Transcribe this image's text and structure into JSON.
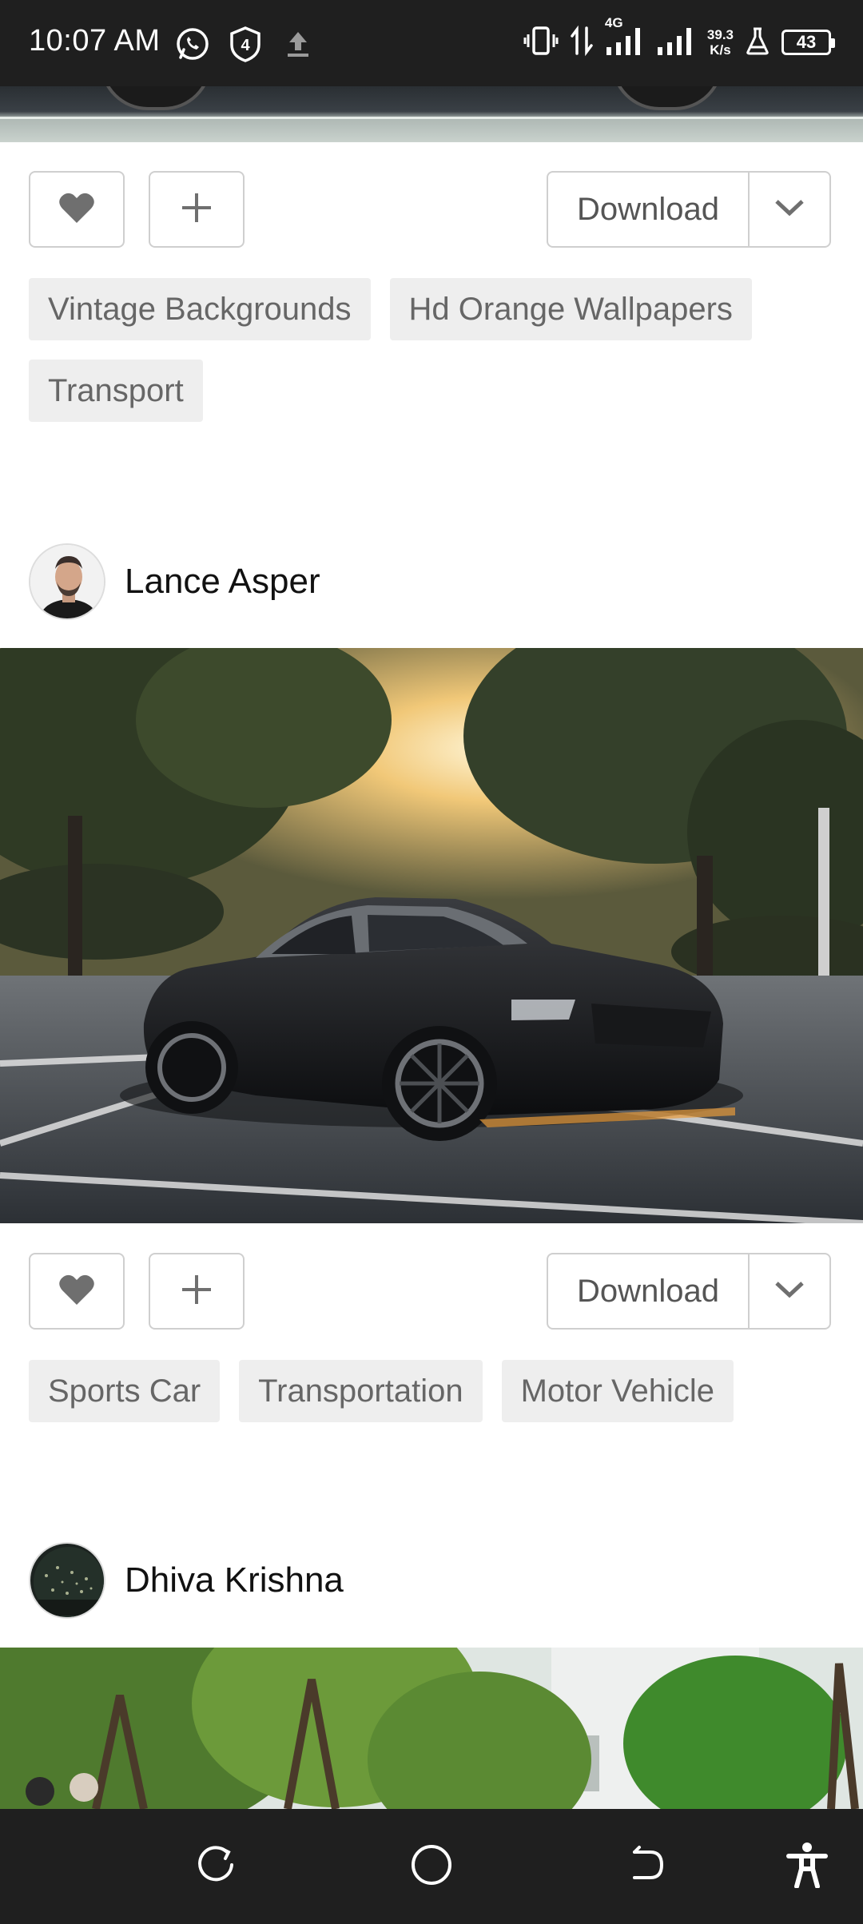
{
  "status_bar": {
    "time": "10:07 AM",
    "network_type": "4G",
    "net_speed_value": "39.3",
    "net_speed_unit": "K/s",
    "battery_level": "43",
    "shield_number": "4"
  },
  "posts": [
    {
      "actions": {
        "download_label": "Download"
      },
      "tags": [
        "Vintage Backgrounds",
        "Hd Orange Wallpapers",
        "Transport"
      ]
    },
    {
      "author": "Lance Asper",
      "actions": {
        "download_label": "Download"
      },
      "tags": [
        "Sports Car",
        "Transportation",
        "Motor Vehicle"
      ]
    },
    {
      "author": "Dhiva Krishna"
    }
  ],
  "icons": {
    "status_left": [
      "whatsapp-icon",
      "shield-icon",
      "upload-icon"
    ],
    "status_right": [
      "vibrate-icon",
      "data-transfer-icon",
      "signal-icon",
      "signal-icon",
      "flask-icon",
      "battery-icon"
    ],
    "post_actions": [
      "heart-icon",
      "plus-icon",
      "chevron-down-icon"
    ],
    "nav": [
      "rotate-icon",
      "home-icon",
      "back-icon",
      "accessibility-icon"
    ]
  },
  "colors": {
    "system_bar": "#1f1f1f",
    "tag_background": "#eeeeee",
    "tag_text": "#666666",
    "button_border": "#cfcfcf"
  }
}
